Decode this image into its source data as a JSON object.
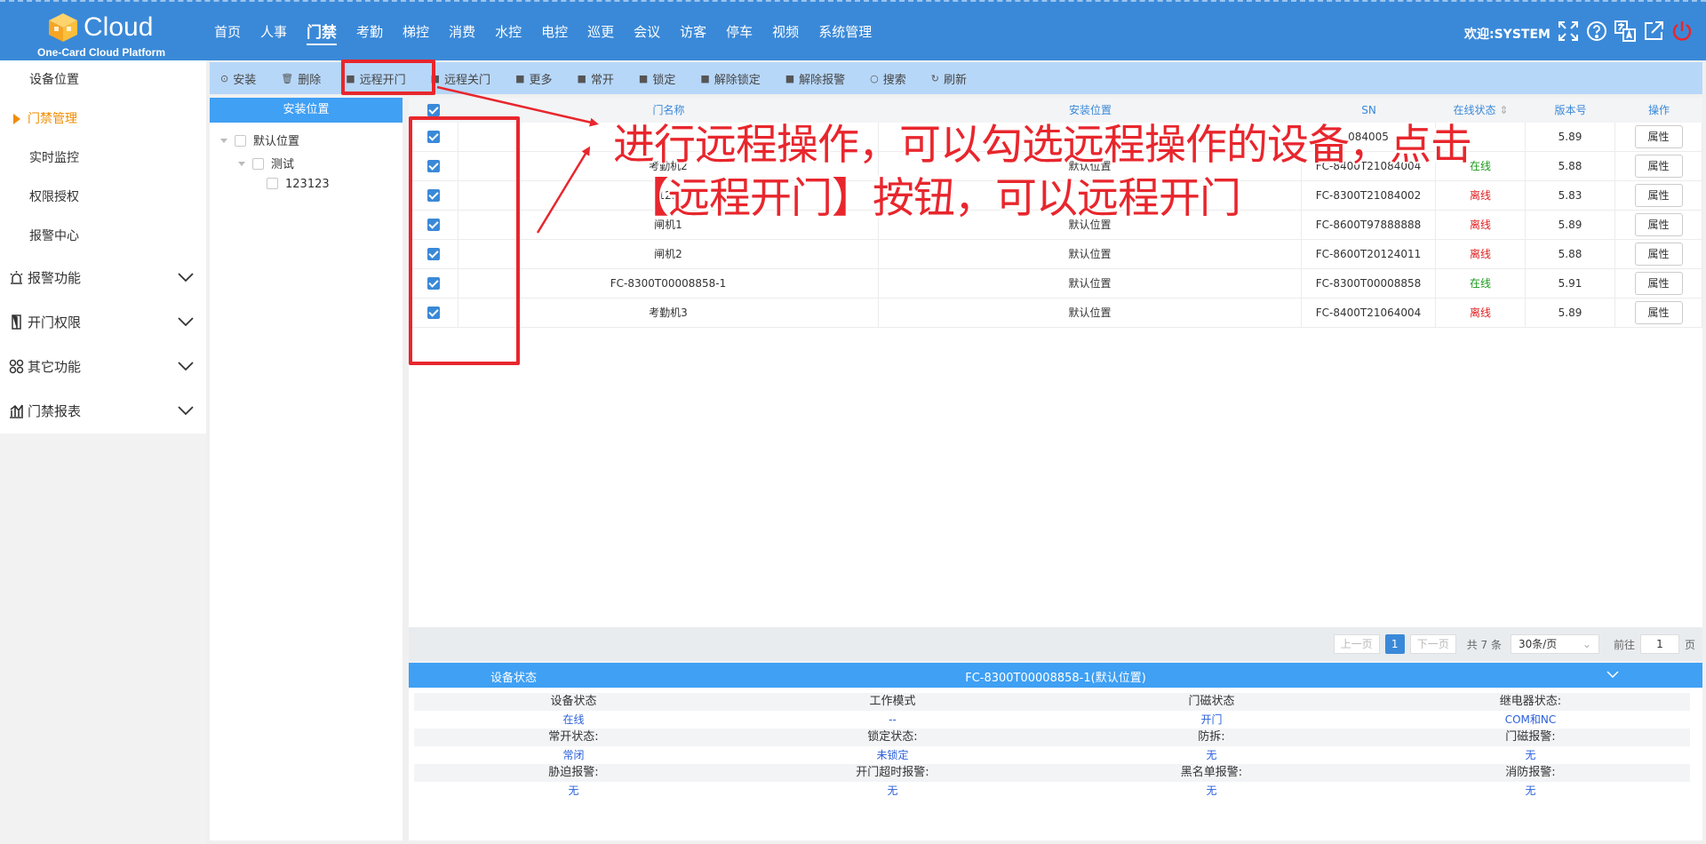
{
  "header": {
    "brand": "Cloud",
    "subtitle": "One-Card Cloud Platform",
    "nav": [
      "首页",
      "人事",
      "门禁",
      "考勤",
      "梯控",
      "消费",
      "水控",
      "电控",
      "巡更",
      "会议",
      "访客",
      "停车",
      "视频",
      "系统管理"
    ],
    "nav_active": "门禁",
    "welcome": "欢迎:SYSTEM",
    "icons": [
      "fullscreen-icon",
      "help-icon",
      "language-icon",
      "external-link-icon",
      "power-icon"
    ]
  },
  "sidebar": {
    "sub_items": [
      "设备位置",
      "门禁管理",
      "实时监控",
      "权限授权",
      "报警中心"
    ],
    "active": "门禁管理",
    "groups": [
      {
        "label": "报警功能",
        "icon": "alarm-icon"
      },
      {
        "label": "开门权限",
        "icon": "door-icon"
      },
      {
        "label": "其它功能",
        "icon": "other-icon"
      },
      {
        "label": "门禁报表",
        "icon": "report-icon"
      }
    ]
  },
  "toolbar": {
    "buttons": [
      {
        "label": "安装",
        "icon": "install-icon"
      },
      {
        "label": "删除",
        "icon": "delete-icon"
      },
      {
        "label": "远程开门",
        "icon": "monitor-icon"
      },
      {
        "label": "远程关门",
        "icon": "monitor-icon"
      },
      {
        "label": "更多",
        "icon": "monitor-icon"
      },
      {
        "label": "常开",
        "icon": "monitor-icon"
      },
      {
        "label": "锁定",
        "icon": "monitor-icon"
      },
      {
        "label": "解除锁定",
        "icon": "monitor-icon"
      },
      {
        "label": "解除报警",
        "icon": "monitor-icon"
      },
      {
        "label": "搜索",
        "icon": "search-icon"
      },
      {
        "label": "刷新",
        "icon": "refresh-icon"
      }
    ]
  },
  "tree": {
    "title": "安装位置",
    "nodes": [
      "默认位置",
      "测试",
      "123123"
    ]
  },
  "table": {
    "columns": [
      "门名称",
      "安装位置",
      "SN",
      "在线状态",
      "版本号",
      "操作"
    ],
    "rows": [
      {
        "name": "",
        "location": "",
        "sn": "084005",
        "status": "",
        "version": "5.89",
        "action": "属性"
      },
      {
        "name": "考勤机2",
        "location": "默认位置",
        "sn": "FC-8400T21084004",
        "status": "在线",
        "version": "5.88",
        "action": "属性"
      },
      {
        "name": "123",
        "location": "",
        "sn": "FC-8300T21084002",
        "status": "离线",
        "version": "5.83",
        "action": "属性"
      },
      {
        "name": "闸机1",
        "location": "默认位置",
        "sn": "FC-8600T97888888",
        "status": "离线",
        "version": "5.89",
        "action": "属性"
      },
      {
        "name": "闸机2",
        "location": "默认位置",
        "sn": "FC-8600T20124011",
        "status": "离线",
        "version": "5.88",
        "action": "属性"
      },
      {
        "name": "FC-8300T00008858-1",
        "location": "默认位置",
        "sn": "FC-8300T00008858",
        "status": "在线",
        "version": "5.91",
        "action": "属性"
      },
      {
        "name": "考勤机3",
        "location": "默认位置",
        "sn": "FC-8400T21064004",
        "status": "离线",
        "version": "5.89",
        "action": "属性"
      }
    ]
  },
  "pager": {
    "prev": "上一页",
    "page": "1",
    "next": "下一页",
    "total": "共 7 条",
    "page_size": "30条/页",
    "goto": "前往",
    "goto_value": "1",
    "goto_unit": "页"
  },
  "device_status": {
    "title": "设备状态",
    "device": "FC-8300T00008858-1(默认位置)",
    "rows": [
      {
        "labels": [
          "设备状态",
          "工作模式",
          "门磁状态",
          "继电器状态:"
        ],
        "values": [
          "在线",
          "--",
          "开门",
          "COM和NC"
        ]
      },
      {
        "labels": [
          "常开状态:",
          "锁定状态:",
          "防拆:",
          "门磁报警:"
        ],
        "values": [
          "常闭",
          "未锁定",
          "无",
          "无"
        ]
      },
      {
        "labels": [
          "胁迫报警:",
          "开门超时报警:",
          "黑名单报警:",
          "消防报警:"
        ],
        "values": [
          "无",
          "无",
          "无",
          "无"
        ]
      }
    ]
  },
  "annotation": {
    "line1": "进行远程操作，可以勾选远程操作的设备，点击",
    "line2": "【远程开门】按钮，可以远程开门",
    "color": "#e8262d"
  }
}
